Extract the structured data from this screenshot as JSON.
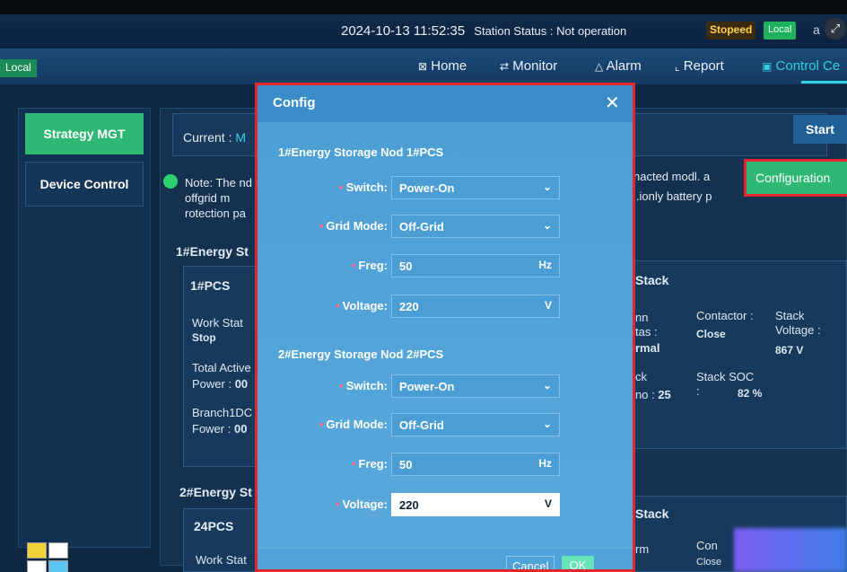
{
  "header": {
    "datetime": "2024-10-13 11:52:35",
    "station_status_label": "Station Status : Not operation",
    "status_badge": "Stopeed",
    "local_button": "Local",
    "status_suffix": "a"
  },
  "nav": {
    "local_tag": "Local",
    "items": [
      {
        "label": "Home",
        "icon": "home-icon",
        "glyph": "⊠"
      },
      {
        "label": "Monitor",
        "icon": "monitor-icon",
        "glyph": "⇄"
      },
      {
        "label": "Alarm",
        "icon": "alarm-icon",
        "glyph": "△"
      },
      {
        "label": "Report",
        "icon": "report-icon",
        "glyph": "⌞"
      },
      {
        "label": "Control Ce",
        "icon": "control-icon",
        "glyph": "▣"
      }
    ]
  },
  "sidebar": {
    "strategy": "Strategy MGT",
    "device_control": "Device Control"
  },
  "content": {
    "current_label": "Current :",
    "current_value": "M",
    "start_button": "Start",
    "note_text": "Note: The nd offgrid m rotection pa",
    "note_right_1": "nacted modl. a",
    "note_right_2": "l.ionly battery p",
    "configuration_button": "Configuration",
    "node1_title": "1#Energy St",
    "node1_pcs": "1#PCS",
    "work_state_label": "Work Stat",
    "work_state_value": "Stop",
    "total_active_label": "Total Active",
    "power_label": "Power :",
    "power_value": "00",
    "branch_label": "Branch1DC",
    "fower_label": "Fower :",
    "fower_value": "00",
    "node2_title": "2#Energy St",
    "node2_pcs": "24PCS",
    "work_state2_label": "Work Stat",
    "stack_title": "Stack",
    "conn_label": "nn",
    "atus_label": "tas :",
    "atus_value": "rmal",
    "contactor_label": "Contactor :",
    "contactor_value": "Close",
    "stack_voltage_label": "Stack Voltage :",
    "stack_voltage_value": "867 V",
    "ck_label": "ck",
    "no_label": "no :",
    "no_value": "25",
    "stack_soc_label": "Stack SOC :",
    "stack_soc_value": "82 %",
    "stack2_title": "Stack",
    "rm_label": "rm",
    "con_label": "Con",
    "close2": "Close"
  },
  "modal": {
    "title": "Config",
    "group1_title": "1#Energy Storage Nod 1#PCS",
    "group2_title": "2#Energy Storage Nod 2#PCS",
    "g1": {
      "switch_label": "Switch:",
      "switch_value": "Power-On",
      "grid_label": "Grid Mode:",
      "grid_value": "Off-Grid",
      "freq_label": "Freg:",
      "freq_value": "50",
      "freq_unit": "Hz",
      "voltage_label": "Voltage:",
      "voltage_value": "220",
      "voltage_unit": "V"
    },
    "g2": {
      "switch_label": "Switch:",
      "switch_value": "Power-On",
      "grid_label": "Grid Mode:",
      "grid_value": "Off-Grid",
      "freq_label": "Freg:",
      "freq_value": "50",
      "freq_unit": "Hz",
      "voltage_label": "Voltage:",
      "voltage_value": "220",
      "voltage_unit": "V"
    },
    "cancel_button": "Cancel",
    "ok_button": "OK"
  },
  "colors": {
    "accent_green": "#2fb874",
    "highlight_red": "#e3262d",
    "modal_blue": "#4b9ed4",
    "active_nav": "#36d1e6"
  }
}
